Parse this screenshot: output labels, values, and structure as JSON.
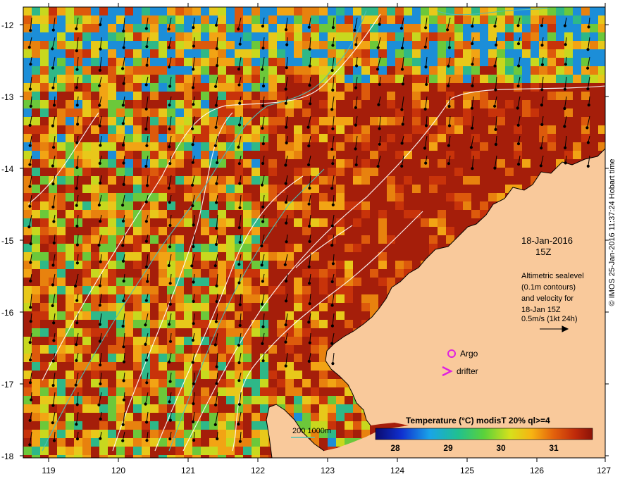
{
  "map": {
    "lat_labels": [
      "-12",
      "-13",
      "-14",
      "-15",
      "-16",
      "-17",
      "-18"
    ],
    "lon_labels": [
      "119",
      "120",
      "121",
      "122",
      "123",
      "124",
      "125",
      "126",
      "127"
    ],
    "lat_range": [
      -18,
      -11.7
    ],
    "lon_range": [
      118.65,
      127.0
    ]
  },
  "annotations": {
    "date": "18-Jan-2016",
    "time": "15Z",
    "altimetry_lines": [
      "Altimetric sealevel",
      "(0.1m contours)",
      "and velocity for",
      "18-Jan 15Z",
      "0.5m/s (1kt 24h)"
    ],
    "argo_label": "Argo",
    "drifter_label": "drifter",
    "depth_legend": "200  1000m"
  },
  "colorbar": {
    "title": "Temperature (°C) modisT 20% ql>=4",
    "ticks": [
      "28",
      "29",
      "30",
      "31"
    ]
  },
  "credit": "© IMOS 25-Jan-2016 11:37:24 Hobart time",
  "colors": {
    "land": "#f9c99b",
    "warm": "#a51e0a",
    "contour": "#ffffff",
    "bathymetry": "#4dbfb5",
    "argo": "#e020e0",
    "drifter": "#e020e0"
  }
}
